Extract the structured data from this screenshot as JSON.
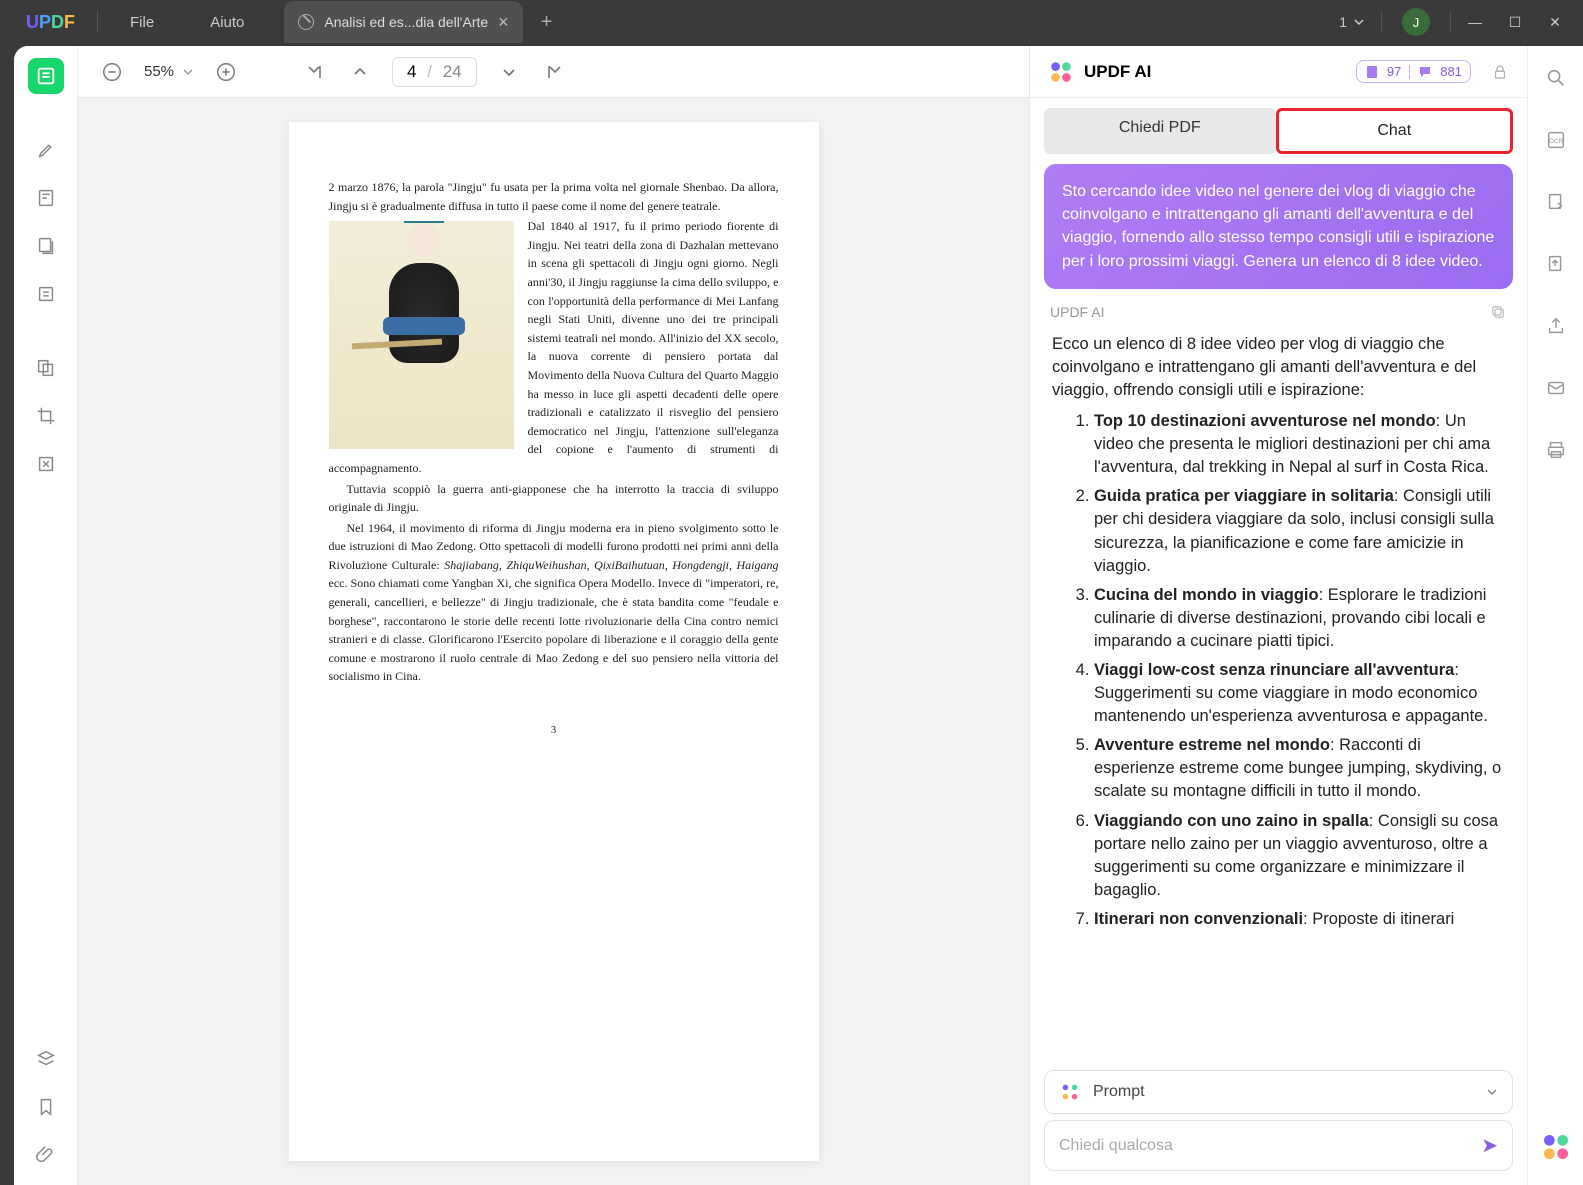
{
  "titlebar": {
    "menu_file": "File",
    "menu_help": "Aiuto",
    "tab_title": "Analisi ed es...dia dell'Arte",
    "win_count": "1",
    "avatar_letter": "J"
  },
  "doc_toolbar": {
    "zoom": "55%",
    "page_current": "4",
    "page_sep": "/",
    "page_total": "24"
  },
  "page": {
    "p1": "2 marzo 1876, la parola \"Jingju\" fu usata per la prima volta nel giornale Shenbao. Da allora, Jingju si è gradualmente diffusa in tutto il paese come il nome del genere teatrale.",
    "p2": "Dal 1840 al 1917, fu il primo periodo fiorente di Jingju. Nei teatri della zona di Dazhalan mettevano in scena gli spettacoli di Jingju ogni giorno. Negli anni'30, il Jingju raggiunse la cima dello sviluppo, e con l'opportunità della performance di Mei Lanfang negli Stati Uniti, divenne uno dei tre principali sistemi teatrali nel mondo. All'inizio del XX secolo, la nuova corrente di pensiero portata dal Movimento della Nuova Cultura del Quarto Maggio ha messo in luce gli aspetti decadenti delle opere tradizionali e catalizzato il risveglio del pensiero democratico nel Jingju, l'attenzione sull'eleganza del copione e l'aumento di strumenti di accompagnamento.",
    "p3": "Tuttavia scoppiò la guerra anti-giapponese che ha interrotto la traccia di sviluppo originale di Jingju.",
    "p4a": "Nel 1964, il movimento di riforma di Jingju moderna era in pieno svolgimento sotto le due istruzioni di Mao Zedong. Otto spettacoli di modelli furono prodotti nei primi anni della Rivoluzione Culturale: ",
    "p4i": "Shajiabang, ZhiquWeihushan, QixiBaihutuan, Hongdengji, Haigang",
    "p4b": " ecc. Sono chiamati come Yangban Xi, che significa Opera Modello. Invece di \"imperatori, re, generali, cancellieri, e bellezze\" di Jingju tradizionale, che è stata bandita come \"feudale e borghese\", raccontarono le storie delle recenti lotte rivoluzionarie della Cina contro nemici stranieri e di classe. Glorificarono l'Esercito popolare di liberazione e il coraggio della gente comune e mostrarono il ruolo centrale di Mao Zedong e del suo pensiero nella vittoria del socialismo in Cina.",
    "pagenum": "3"
  },
  "ai": {
    "title": "UPDF AI",
    "credit1": "97",
    "credit2": "881",
    "tab_ask": "Chiedi PDF",
    "tab_chat": "Chat",
    "user_msg": "Sto cercando idee video nel genere dei vlog di viaggio che coinvolgano e intrattengano gli amanti dell'avventura e del viaggio, fornendo allo stesso tempo consigli utili e ispirazione per i loro prossimi viaggi. Genera un elenco di 8 idee video.",
    "ai_label": "UPDF AI",
    "intro": "Ecco un elenco di 8 idee video per vlog di viaggio che coinvolgano e intrattengano gli amanti dell'avventura e del viaggio, offrendo consigli utili e ispirazione:",
    "items": [
      {
        "t": "Top 10 destinazioni avventurose nel mondo",
        "d": ": Un video che presenta le migliori destinazioni per chi ama l'avventura, dal trekking in Nepal al surf in Costa Rica."
      },
      {
        "t": "Guida pratica per viaggiare in solitaria",
        "d": ": Consigli utili per chi desidera viaggiare da solo, inclusi consigli sulla sicurezza, la pianificazione e come fare amicizie in viaggio."
      },
      {
        "t": "Cucina del mondo in viaggio",
        "d": ": Esplorare le tradizioni culinarie di diverse destinazioni, provando cibi locali e imparando a cucinare piatti tipici."
      },
      {
        "t": "Viaggi low-cost senza rinunciare all'avventura",
        "d": ": Suggerimenti su come viaggiare in modo economico mantenendo un'esperienza avventurosa e appagante."
      },
      {
        "t": "Avventure estreme nel mondo",
        "d": ": Racconti di esperienze estreme come bungee jumping, skydiving, o scalate su montagne difficili in tutto il mondo."
      },
      {
        "t": "Viaggiando con uno zaino in spalla",
        "d": ": Consigli su cosa portare nello zaino per un viaggio avventuroso, oltre a suggerimenti su come organizzare e minimizzare il bagaglio."
      },
      {
        "t": "Itinerari non convenzionali",
        "d": ": Proposte di itinerari"
      }
    ],
    "prompt_label": "Prompt",
    "input_placeholder": "Chiedi qualcosa"
  }
}
